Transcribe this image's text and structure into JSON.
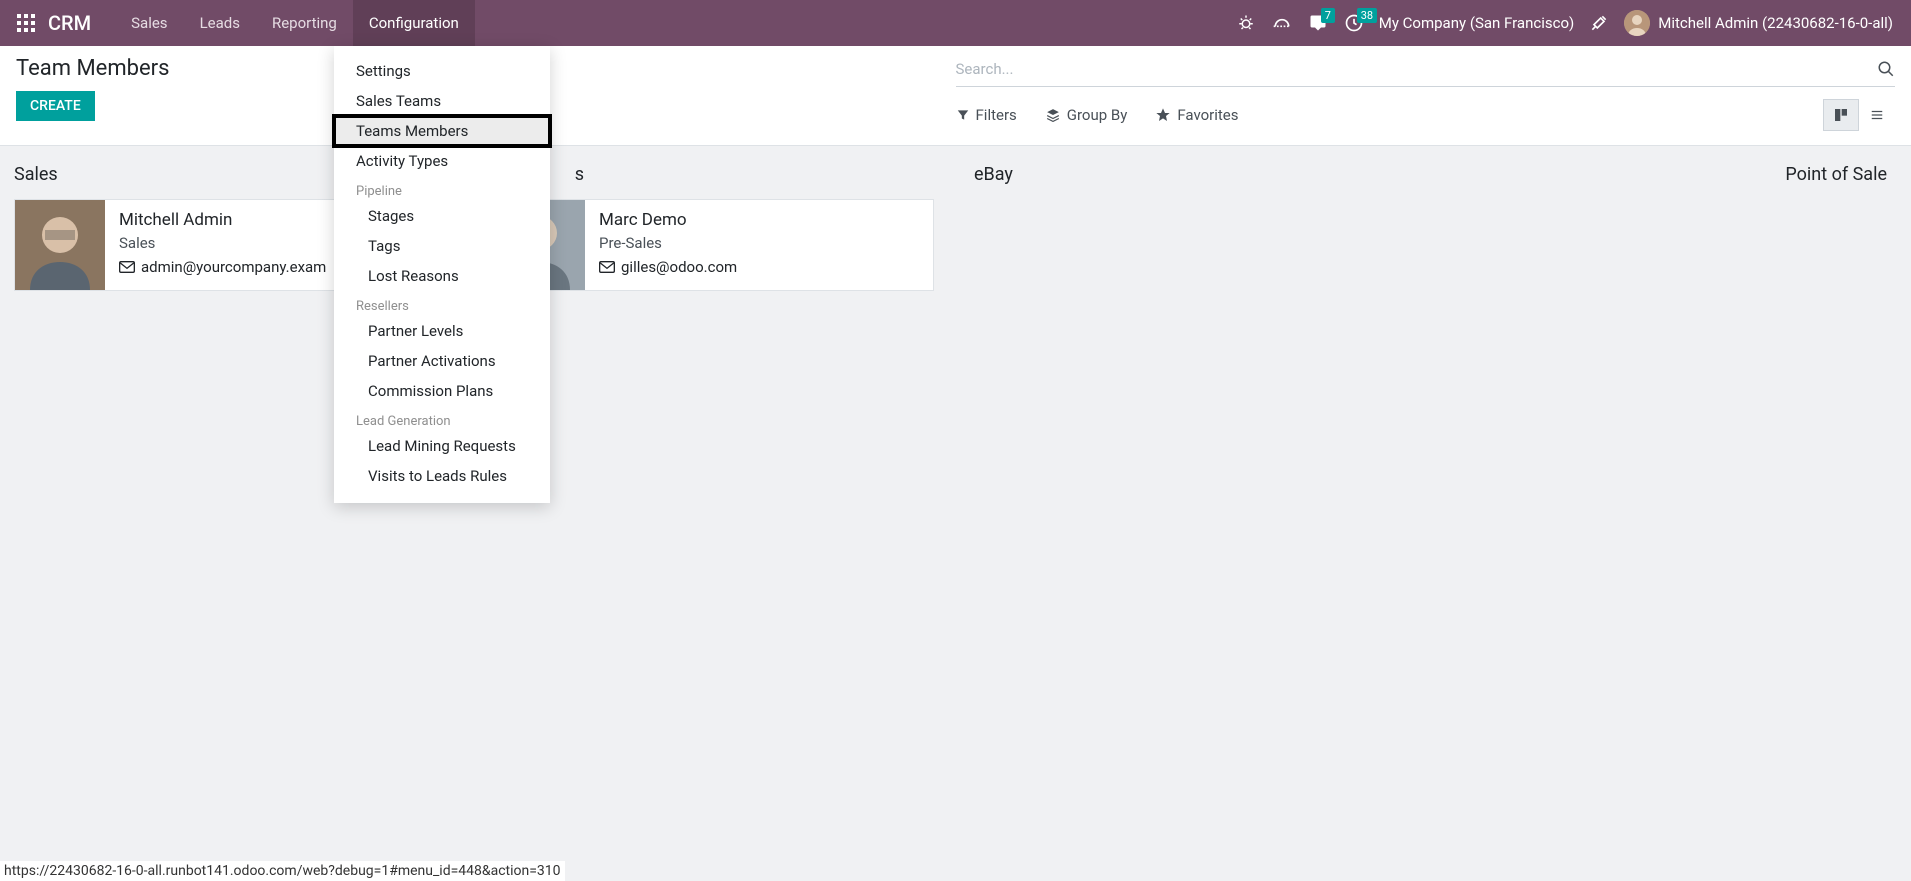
{
  "navbar": {
    "brand": "CRM",
    "menu": [
      "Sales",
      "Leads",
      "Reporting",
      "Configuration"
    ],
    "messages_badge": "7",
    "activities_badge": "38",
    "company": "My Company (San Francisco)",
    "user": "Mitchell Admin (22430682-16-0-all)"
  },
  "control_panel": {
    "title": "Team Members",
    "create": "CREATE",
    "search_placeholder": "Search...",
    "filters": "Filters",
    "group_by": "Group By",
    "favorites": "Favorites"
  },
  "dropdown": {
    "items_top": [
      "Settings",
      "Sales Teams",
      "Teams Members",
      "Activity Types"
    ],
    "pipeline_header": "Pipeline",
    "pipeline_items": [
      "Stages",
      "Tags",
      "Lost Reasons"
    ],
    "resellers_header": "Resellers",
    "resellers_items": [
      "Partner Levels",
      "Partner Activations",
      "Commission Plans"
    ],
    "leadgen_header": "Lead Generation",
    "leadgen_items": [
      "Lead Mining Requests",
      "Visits to Leads Rules"
    ]
  },
  "columns": {
    "c0": "Sales",
    "c1_hidden_suffix": "s",
    "c2": "eBay",
    "c3": "Point of Sale"
  },
  "cards": {
    "card0": {
      "name": "Mitchell Admin",
      "role": "Sales",
      "email": "admin@yourcompany.exam"
    },
    "card1": {
      "name": "Marc Demo",
      "role": "Pre-Sales",
      "email": "gilles@odoo.com"
    }
  },
  "status_url": "https://22430682-16-0-all.runbot141.odoo.com/web?debug=1#menu_id=448&action=310"
}
